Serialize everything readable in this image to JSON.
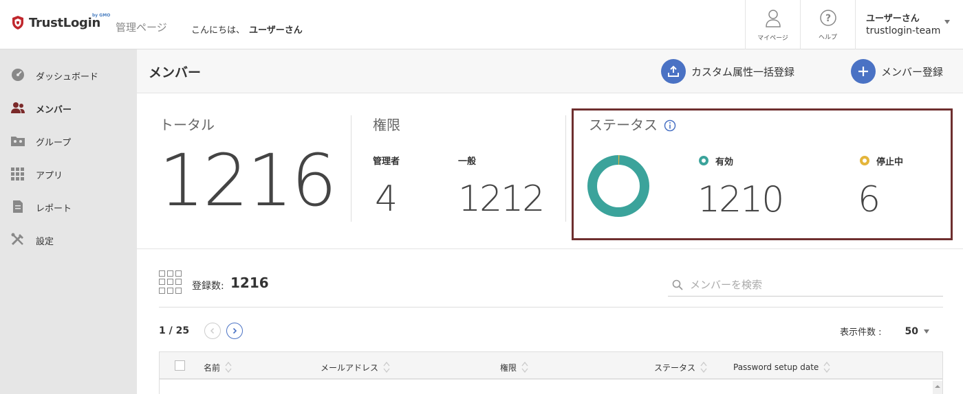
{
  "header": {
    "logo_text": "TrustLogin",
    "logo_sub": "by GMO",
    "admin_label": "管理ページ",
    "greeting": "こんにちは、",
    "greeting_name": "ユーザーさん",
    "mypage_label": "マイページ",
    "help_label": "ヘルプ",
    "user_name": "ユーザーさん",
    "user_team": "trustlogin-team"
  },
  "sidebar": {
    "items": [
      {
        "label": "ダッシュボード",
        "icon": "dashboard-icon"
      },
      {
        "label": "メンバー",
        "icon": "members-icon",
        "active": true
      },
      {
        "label": "グループ",
        "icon": "group-icon"
      },
      {
        "label": "アプリ",
        "icon": "apps-icon"
      },
      {
        "label": "レポート",
        "icon": "report-icon"
      },
      {
        "label": "設定",
        "icon": "settings-icon"
      }
    ]
  },
  "main": {
    "title": "メンバー",
    "bulk_label": "カスタム属性一括登録",
    "add_label": "メンバー登録"
  },
  "stats": {
    "total_label": "トータル",
    "total_value": "1216",
    "role_label": "権限",
    "admin_label": "管理者",
    "admin_value": "4",
    "general_label": "一般",
    "general_value": "1212",
    "status_label": "ステータス",
    "active_label": "有効",
    "active_value": "1210",
    "paused_label": "停止中",
    "paused_value": "6",
    "active_fraction": 0.995
  },
  "list": {
    "reg_label": "登録数:",
    "reg_value": "1216",
    "search_placeholder": "メンバーを検索",
    "page_text": "1 / 25",
    "per_page_label": "表示件数 :",
    "per_page_value": "50",
    "columns": [
      "名前",
      "メールアドレス",
      "権限",
      "ステータス",
      "Password setup date"
    ]
  },
  "colors": {
    "accent": "#4a72c4",
    "active": "#3ba39b",
    "paused": "#e4b53b",
    "brand": "#c0272d",
    "highlight_border": "#6e2f2f"
  }
}
